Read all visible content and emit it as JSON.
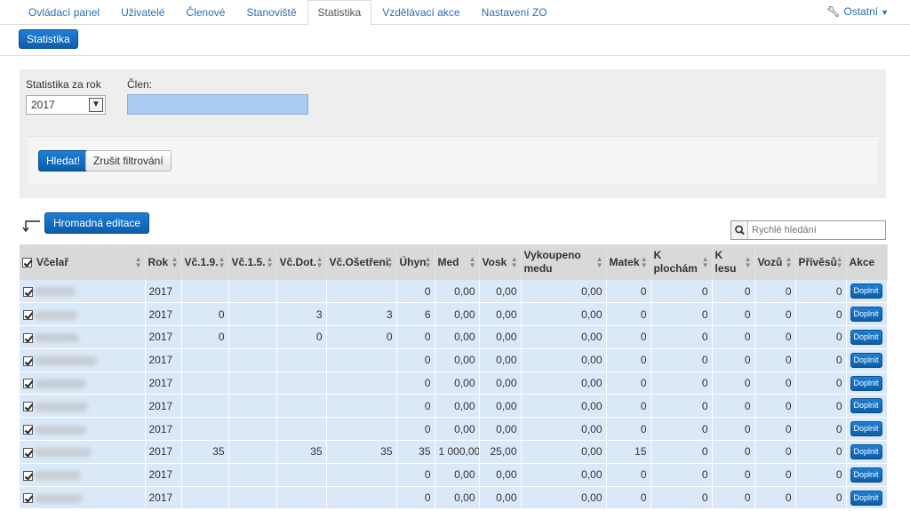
{
  "nav": {
    "tabs": [
      "Ovládací panel",
      "Uživatelé",
      "Členové",
      "Stanoviště",
      "Statistika",
      "Vzdělávací akce",
      "Nastavení ZO"
    ],
    "active_index": 4,
    "other_label": "Ostatní"
  },
  "subnav": {
    "button_label": "Statistika"
  },
  "filter": {
    "year_label": "Statistika za rok",
    "year_value": "2017",
    "member_label": "Člen:",
    "search_label": "Hledat!",
    "clear_label": "Zrušit filtrování"
  },
  "bulk_edit_label": "Hromadná editace",
  "quick_search_placeholder": "Rychlé hledání",
  "table": {
    "headers": [
      "Včelař",
      "Rok",
      "Vč.1.9.",
      "Vč.1.5.",
      "Vč.Dot.",
      "Vč.Ošetřeni",
      "Úhyn",
      "Med",
      "Vosk",
      "Vykoupeno medu",
      "Matek",
      "K plochám",
      "K lesu",
      "Vozů",
      "Přívěsů",
      "Akce"
    ],
    "action_label": "Doplnit",
    "rows": [
      {
        "year": "2017",
        "v19": "",
        "v15": "",
        "vdot": "",
        "vos": "",
        "uhyn": "0",
        "med": "0,00",
        "vosk": "0,00",
        "vyk": "0,00",
        "matek": "0",
        "kpl": "0",
        "kles": "0",
        "vozu": "0",
        "privesu": "0"
      },
      {
        "year": "2017",
        "v19": "0",
        "v15": "",
        "vdot": "3",
        "vos": "3",
        "uhyn": "6",
        "med": "0,00",
        "vosk": "0,00",
        "vyk": "0,00",
        "matek": "0",
        "kpl": "0",
        "kles": "0",
        "vozu": "0",
        "privesu": "0"
      },
      {
        "year": "2017",
        "v19": "0",
        "v15": "",
        "vdot": "0",
        "vos": "0",
        "uhyn": "0",
        "med": "0,00",
        "vosk": "0,00",
        "vyk": "0,00",
        "matek": "0",
        "kpl": "0",
        "kles": "0",
        "vozu": "0",
        "privesu": "0"
      },
      {
        "year": "2017",
        "v19": "",
        "v15": "",
        "vdot": "",
        "vos": "",
        "uhyn": "0",
        "med": "0,00",
        "vosk": "0,00",
        "vyk": "0,00",
        "matek": "0",
        "kpl": "0",
        "kles": "0",
        "vozu": "0",
        "privesu": "0"
      },
      {
        "year": "2017",
        "v19": "",
        "v15": "",
        "vdot": "",
        "vos": "",
        "uhyn": "0",
        "med": "0,00",
        "vosk": "0,00",
        "vyk": "0,00",
        "matek": "0",
        "kpl": "0",
        "kles": "0",
        "vozu": "0",
        "privesu": "0"
      },
      {
        "year": "2017",
        "v19": "",
        "v15": "",
        "vdot": "",
        "vos": "",
        "uhyn": "0",
        "med": "0,00",
        "vosk": "0,00",
        "vyk": "0,00",
        "matek": "0",
        "kpl": "0",
        "kles": "0",
        "vozu": "0",
        "privesu": "0"
      },
      {
        "year": "2017",
        "v19": "",
        "v15": "",
        "vdot": "",
        "vos": "",
        "uhyn": "0",
        "med": "0,00",
        "vosk": "0,00",
        "vyk": "0,00",
        "matek": "0",
        "kpl": "0",
        "kles": "0",
        "vozu": "0",
        "privesu": "0"
      },
      {
        "year": "2017",
        "v19": "35",
        "v15": "",
        "vdot": "35",
        "vos": "35",
        "uhyn": "35",
        "med": "1 000,00",
        "vosk": "25,00",
        "vyk": "0,00",
        "matek": "15",
        "kpl": "0",
        "kles": "0",
        "vozu": "0",
        "privesu": "0"
      },
      {
        "year": "2017",
        "v19": "",
        "v15": "",
        "vdot": "",
        "vos": "",
        "uhyn": "0",
        "med": "0,00",
        "vosk": "0,00",
        "vyk": "0,00",
        "matek": "0",
        "kpl": "0",
        "kles": "0",
        "vozu": "0",
        "privesu": "0"
      },
      {
        "year": "2017",
        "v19": "",
        "v15": "",
        "vdot": "",
        "vos": "",
        "uhyn": "0",
        "med": "0,00",
        "vosk": "0,00",
        "vyk": "0,00",
        "matek": "0",
        "kpl": "0",
        "kles": "0",
        "vozu": "0",
        "privesu": "0"
      }
    ]
  }
}
